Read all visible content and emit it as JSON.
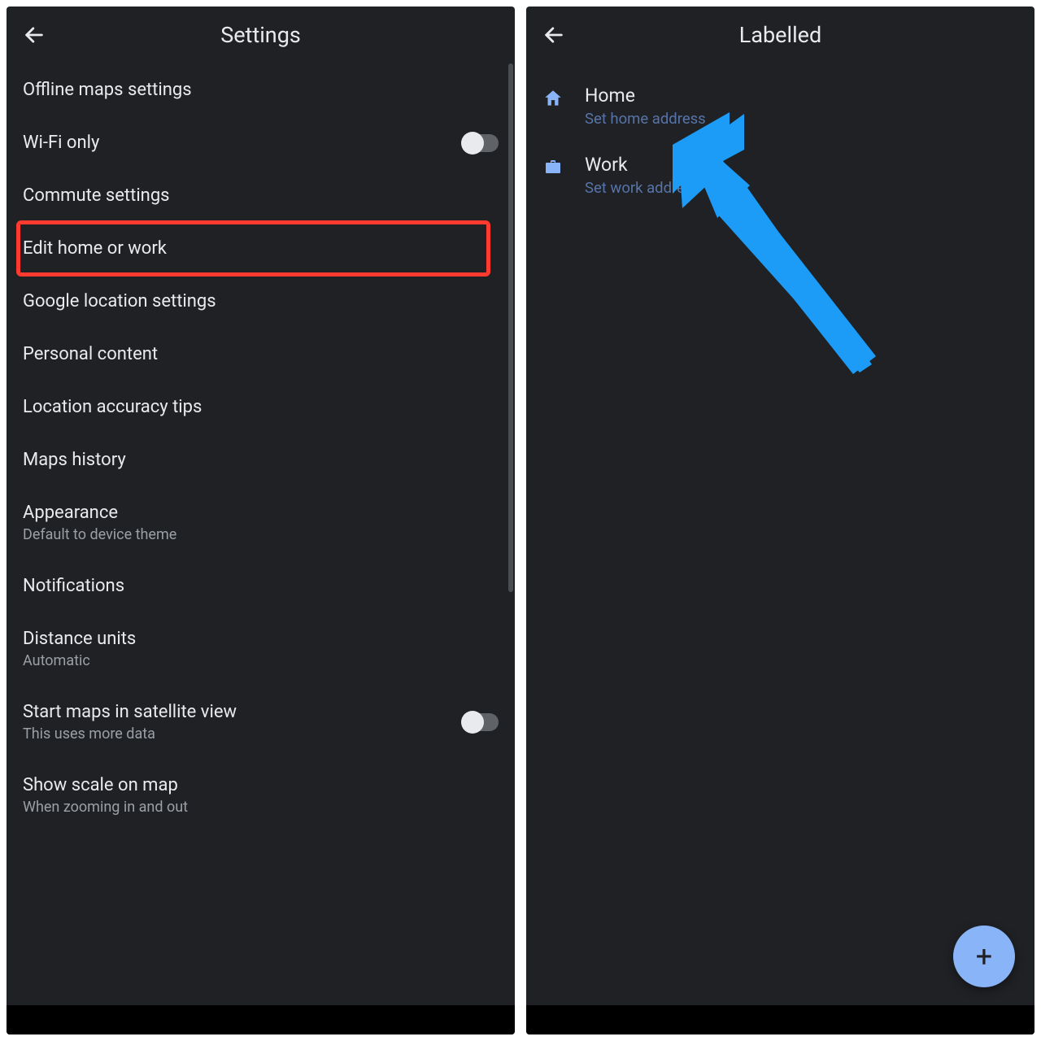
{
  "left": {
    "title": "Settings",
    "items": [
      {
        "label": "Offline maps settings"
      },
      {
        "label": "Wi-Fi only",
        "toggle": true
      },
      {
        "label": "Commute settings"
      },
      {
        "label": "Edit home or work",
        "highlighted": true
      },
      {
        "label": "Google location settings"
      },
      {
        "label": "Personal content"
      },
      {
        "label": "Location accuracy tips"
      },
      {
        "label": "Maps history"
      },
      {
        "label": "Appearance",
        "sub": "Default to device theme"
      },
      {
        "label": "Notifications"
      },
      {
        "label": "Distance units",
        "sub": "Automatic"
      },
      {
        "label": "Start maps in satellite view",
        "sub": "This uses more data",
        "toggle": true
      },
      {
        "label": "Show scale on map",
        "sub": "When zooming in and out"
      }
    ]
  },
  "right": {
    "title": "Labelled",
    "items": [
      {
        "icon": "home",
        "title": "Home",
        "sub": "Set home address"
      },
      {
        "icon": "work",
        "title": "Work",
        "sub": "Set work address"
      }
    ],
    "fab": "+"
  },
  "colors": {
    "highlight": "#ff3b2f",
    "accent": "#8ab4f8",
    "arrow": "#1c9cf6"
  }
}
